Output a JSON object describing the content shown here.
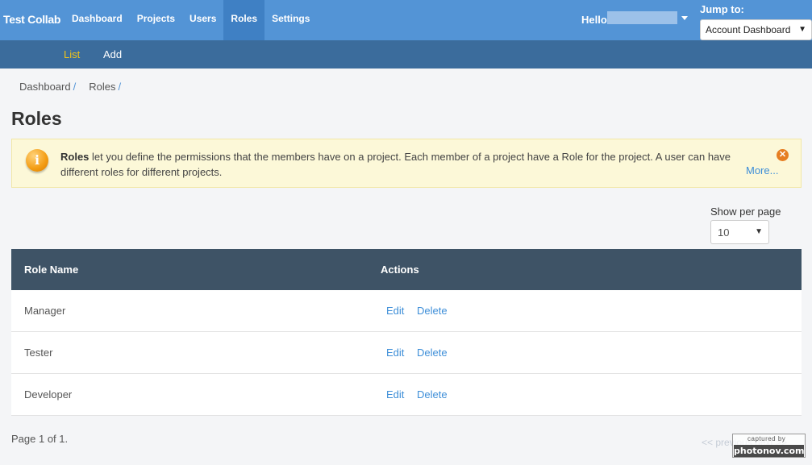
{
  "topbar": {
    "brand": "Test Collab",
    "nav": [
      {
        "label": "Dashboard",
        "active": false
      },
      {
        "label": "Projects",
        "active": false
      },
      {
        "label": "Users",
        "active": false
      },
      {
        "label": "Roles",
        "active": true
      },
      {
        "label": "Settings",
        "active": false
      }
    ],
    "hello_label": "Hello",
    "jump_label": "Jump to:",
    "jump_selected": "Account Dashboard"
  },
  "subnav": {
    "list_label": "List",
    "add_label": "Add"
  },
  "breadcrumb": [
    {
      "label": "Dashboard",
      "sep": "/"
    },
    {
      "label": "Roles",
      "sep": "/"
    }
  ],
  "page": {
    "title": "Roles"
  },
  "notice": {
    "bold": "Roles",
    "text": " let you define the permissions that the members have on a project. Each member of a project have a Role for the project. A user can have different roles for different projects.",
    "more_label": "More..."
  },
  "perpage": {
    "label": "Show per page",
    "selected": "10"
  },
  "table": {
    "columns": [
      "Role Name",
      "Actions"
    ],
    "rows": [
      {
        "name": "Manager",
        "edit": "Edit",
        "delete": "Delete"
      },
      {
        "name": "Tester",
        "edit": "Edit",
        "delete": "Delete"
      },
      {
        "name": "Developer",
        "edit": "Edit",
        "delete": "Delete"
      }
    ]
  },
  "footer": {
    "page_info": "Page 1 of 1.",
    "pager_label": "<< previous  next >>"
  },
  "watermark": {
    "top": "captured by",
    "bottom": "photonov.com"
  },
  "colors": {
    "topbar": "#5394d6",
    "subbar": "#3b6c9c",
    "table_header": "#3e5366",
    "link": "#3d8ed8",
    "active_subnav": "#f0c419"
  }
}
